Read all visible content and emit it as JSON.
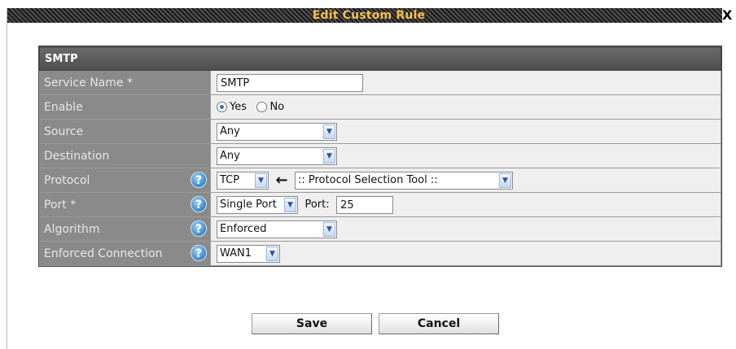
{
  "dialog": {
    "title": "Edit Custom Rule",
    "close_label": "X"
  },
  "section": {
    "header": "SMTP"
  },
  "rows": {
    "service_name": {
      "label": "Service Name *",
      "value": "SMTP"
    },
    "enable": {
      "label": "Enable",
      "options": [
        "Yes",
        "No"
      ],
      "selected": "Yes"
    },
    "source": {
      "label": "Source",
      "value": "Any"
    },
    "destination": {
      "label": "Destination",
      "value": "Any"
    },
    "protocol": {
      "label": "Protocol",
      "value": "TCP",
      "tool": ":: Protocol Selection Tool ::",
      "arrow": "←"
    },
    "port": {
      "label": "Port *",
      "mode": "Single Port",
      "port_label": "Port:",
      "port_value": "25"
    },
    "algorithm": {
      "label": "Algorithm",
      "value": "Enforced"
    },
    "enforced_connection": {
      "label": "Enforced Connection",
      "value": "WAN1"
    }
  },
  "help_glyph": "?",
  "dropdown_glyph": "▼",
  "buttons": {
    "save": "Save",
    "cancel": "Cancel"
  }
}
